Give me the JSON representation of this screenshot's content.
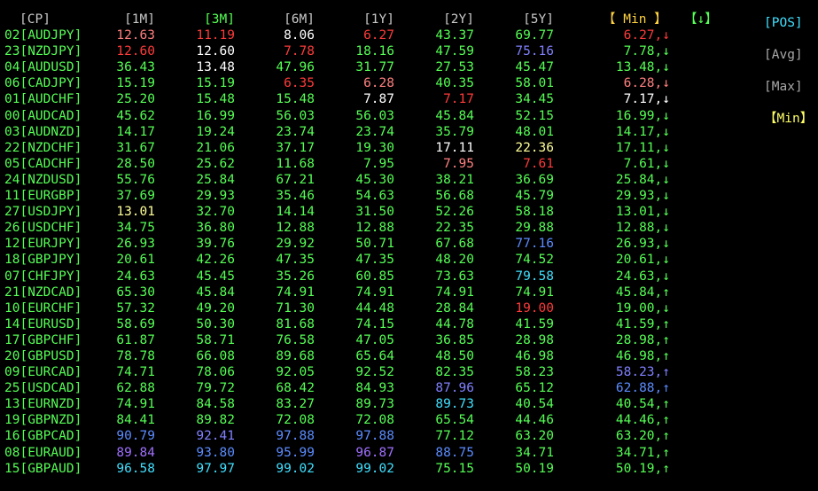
{
  "colors": {
    "green": "#55ff55",
    "white": "#ffffff",
    "red": "#ff3b3b",
    "yellow": "#ffff66",
    "blue": "#5b8cff",
    "purple": "#a070ff",
    "cyan": "#40e0ff",
    "gray": "#a8a8a8",
    "header": "#c8c8c8",
    "min_header": "#ffd23f",
    "sort_header": "#55ff55"
  },
  "headers": {
    "cp": "[CP]",
    "m1": "[1M]",
    "m3": "[3M]",
    "m6": "[6M]",
    "y1": "[1Y]",
    "y2": "[2Y]",
    "y5": "[5Y]",
    "min": "【 Min 】",
    "sort": "【↓】"
  },
  "side_menu": [
    {
      "label": "[POS]",
      "color": "#40e0ff"
    },
    {
      "label": "[Avg]",
      "color": "#a8a8a8"
    },
    {
      "label": "[Max]",
      "color": "#a8a8a8"
    },
    {
      "label": "【Min】",
      "color": "#ffff66"
    }
  ],
  "rows": [
    {
      "pair": "02[AUDJPY]",
      "vals": [
        [
          "12.63",
          "#ff8080"
        ],
        [
          "11.19",
          "#ff3b3b"
        ],
        [
          "8.06",
          "#ffffff"
        ],
        [
          "6.27",
          "#ff3b3b"
        ],
        [
          "43.37",
          "#55ff55"
        ],
        [
          "69.77",
          "#55ff55"
        ]
      ],
      "min": [
        "6.27,",
        "#ff3b3b"
      ],
      "arrow": "↓"
    },
    {
      "pair": "23[NZDJPY]",
      "vals": [
        [
          "12.60",
          "#ff3b3b"
        ],
        [
          "12.60",
          "#ffffff"
        ],
        [
          "7.78",
          "#ff3b3b"
        ],
        [
          "18.16",
          "#55ff55"
        ],
        [
          "47.59",
          "#55ff55"
        ],
        [
          "75.16",
          "#8080ff"
        ]
      ],
      "min": [
        "7.78,",
        "#55ff55"
      ],
      "arrow": "↓"
    },
    {
      "pair": "04[AUDUSD]",
      "vals": [
        [
          "36.43",
          "#55ff55"
        ],
        [
          "13.48",
          "#ffffff"
        ],
        [
          "47.96",
          "#55ff55"
        ],
        [
          "31.77",
          "#55ff55"
        ],
        [
          "27.53",
          "#55ff55"
        ],
        [
          "45.47",
          "#55ff55"
        ]
      ],
      "min": [
        "13.48,",
        "#55ff55"
      ],
      "arrow": "↓"
    },
    {
      "pair": "06[CADJPY]",
      "vals": [
        [
          "15.19",
          "#55ff55"
        ],
        [
          "15.19",
          "#55ff55"
        ],
        [
          "6.35",
          "#ff3b3b"
        ],
        [
          "6.28",
          "#ff8080"
        ],
        [
          "40.35",
          "#55ff55"
        ],
        [
          "58.01",
          "#55ff55"
        ]
      ],
      "min": [
        "6.28,",
        "#ff8080"
      ],
      "arrow": "↓"
    },
    {
      "pair": "01[AUDCHF]",
      "vals": [
        [
          "25.20",
          "#55ff55"
        ],
        [
          "15.48",
          "#55ff55"
        ],
        [
          "15.48",
          "#55ff55"
        ],
        [
          "7.87",
          "#ffffff"
        ],
        [
          "7.17",
          "#ff3b3b"
        ],
        [
          "34.45",
          "#55ff55"
        ]
      ],
      "min": [
        "7.17,",
        "#ffffff"
      ],
      "arrow": "↓"
    },
    {
      "pair": "00[AUDCAD]",
      "vals": [
        [
          "45.62",
          "#55ff55"
        ],
        [
          "16.99",
          "#55ff55"
        ],
        [
          "56.03",
          "#55ff55"
        ],
        [
          "56.03",
          "#55ff55"
        ],
        [
          "45.84",
          "#55ff55"
        ],
        [
          "52.15",
          "#55ff55"
        ]
      ],
      "min": [
        "16.99,",
        "#55ff55"
      ],
      "arrow": "↓"
    },
    {
      "pair": "03[AUDNZD]",
      "vals": [
        [
          "14.17",
          "#55ff55"
        ],
        [
          "19.24",
          "#55ff55"
        ],
        [
          "23.74",
          "#55ff55"
        ],
        [
          "23.74",
          "#55ff55"
        ],
        [
          "35.79",
          "#55ff55"
        ],
        [
          "48.01",
          "#55ff55"
        ]
      ],
      "min": [
        "14.17,",
        "#55ff55"
      ],
      "arrow": "↓"
    },
    {
      "pair": "22[NZDCHF]",
      "vals": [
        [
          "31.67",
          "#55ff55"
        ],
        [
          "21.06",
          "#55ff55"
        ],
        [
          "37.17",
          "#55ff55"
        ],
        [
          "19.30",
          "#55ff55"
        ],
        [
          "17.11",
          "#ffffff"
        ],
        [
          "22.36",
          "#ffff99"
        ]
      ],
      "min": [
        "17.11,",
        "#55ff55"
      ],
      "arrow": "↓"
    },
    {
      "pair": "05[CADCHF]",
      "vals": [
        [
          "28.50",
          "#55ff55"
        ],
        [
          "25.62",
          "#55ff55"
        ],
        [
          "11.68",
          "#55ff55"
        ],
        [
          "7.95",
          "#55ff55"
        ],
        [
          "7.95",
          "#ff8080"
        ],
        [
          "7.61",
          "#ff3b3b"
        ]
      ],
      "min": [
        "7.61,",
        "#55ff55"
      ],
      "arrow": "↓"
    },
    {
      "pair": "24[NZDUSD]",
      "vals": [
        [
          "55.76",
          "#55ff55"
        ],
        [
          "25.84",
          "#55ff55"
        ],
        [
          "67.21",
          "#55ff55"
        ],
        [
          "45.30",
          "#55ff55"
        ],
        [
          "38.21",
          "#55ff55"
        ],
        [
          "36.69",
          "#55ff55"
        ]
      ],
      "min": [
        "25.84,",
        "#55ff55"
      ],
      "arrow": "↓"
    },
    {
      "pair": "11[EURGBP]",
      "vals": [
        [
          "37.69",
          "#55ff55"
        ],
        [
          "29.93",
          "#55ff55"
        ],
        [
          "35.46",
          "#55ff55"
        ],
        [
          "54.63",
          "#55ff55"
        ],
        [
          "56.68",
          "#55ff55"
        ],
        [
          "45.79",
          "#55ff55"
        ]
      ],
      "min": [
        "29.93,",
        "#55ff55"
      ],
      "arrow": "↓"
    },
    {
      "pair": "27[USDJPY]",
      "vals": [
        [
          "13.01",
          "#ffff99"
        ],
        [
          "32.70",
          "#55ff55"
        ],
        [
          "14.14",
          "#55ff55"
        ],
        [
          "31.50",
          "#55ff55"
        ],
        [
          "52.26",
          "#55ff55"
        ],
        [
          "58.18",
          "#55ff55"
        ]
      ],
      "min": [
        "13.01,",
        "#55ff55"
      ],
      "arrow": "↓"
    },
    {
      "pair": "26[USDCHF]",
      "vals": [
        [
          "34.75",
          "#55ff55"
        ],
        [
          "36.80",
          "#55ff55"
        ],
        [
          "12.88",
          "#55ff55"
        ],
        [
          "12.88",
          "#55ff55"
        ],
        [
          "22.35",
          "#55ff55"
        ],
        [
          "29.88",
          "#55ff55"
        ]
      ],
      "min": [
        "12.88,",
        "#55ff55"
      ],
      "arrow": "↓"
    },
    {
      "pair": "12[EURJPY]",
      "vals": [
        [
          "26.93",
          "#55ff55"
        ],
        [
          "39.76",
          "#55ff55"
        ],
        [
          "29.92",
          "#55ff55"
        ],
        [
          "50.71",
          "#55ff55"
        ],
        [
          "67.68",
          "#55ff55"
        ],
        [
          "77.16",
          "#5b8cff"
        ]
      ],
      "min": [
        "26.93,",
        "#55ff55"
      ],
      "arrow": "↓"
    },
    {
      "pair": "18[GBPJPY]",
      "vals": [
        [
          "20.61",
          "#55ff55"
        ],
        [
          "42.26",
          "#55ff55"
        ],
        [
          "47.35",
          "#55ff55"
        ],
        [
          "47.35",
          "#55ff55"
        ],
        [
          "48.20",
          "#55ff55"
        ],
        [
          "74.52",
          "#55ff55"
        ]
      ],
      "min": [
        "20.61,",
        "#55ff55"
      ],
      "arrow": "↓"
    },
    {
      "pair": "07[CHFJPY]",
      "vals": [
        [
          "24.63",
          "#55ff55"
        ],
        [
          "45.45",
          "#55ff55"
        ],
        [
          "35.26",
          "#55ff55"
        ],
        [
          "60.85",
          "#55ff55"
        ],
        [
          "73.63",
          "#55ff55"
        ],
        [
          "79.58",
          "#40e0ff"
        ]
      ],
      "min": [
        "24.63,",
        "#55ff55"
      ],
      "arrow": "↓"
    },
    {
      "pair": "21[NZDCAD]",
      "vals": [
        [
          "65.30",
          "#55ff55"
        ],
        [
          "45.84",
          "#55ff55"
        ],
        [
          "74.91",
          "#55ff55"
        ],
        [
          "74.91",
          "#55ff55"
        ],
        [
          "74.91",
          "#55ff55"
        ],
        [
          "74.91",
          "#55ff55"
        ]
      ],
      "min": [
        "45.84,",
        "#55ff55"
      ],
      "arrow": "↑"
    },
    {
      "pair": "10[EURCHF]",
      "vals": [
        [
          "57.32",
          "#55ff55"
        ],
        [
          "49.20",
          "#55ff55"
        ],
        [
          "71.30",
          "#55ff55"
        ],
        [
          "44.48",
          "#55ff55"
        ],
        [
          "28.84",
          "#55ff55"
        ],
        [
          "19.00",
          "#ff3b3b"
        ]
      ],
      "min": [
        "19.00,",
        "#55ff55"
      ],
      "arrow": "↓"
    },
    {
      "pair": "14[EURUSD]",
      "vals": [
        [
          "58.69",
          "#55ff55"
        ],
        [
          "50.30",
          "#55ff55"
        ],
        [
          "81.68",
          "#55ff55"
        ],
        [
          "74.15",
          "#55ff55"
        ],
        [
          "44.78",
          "#55ff55"
        ],
        [
          "41.59",
          "#55ff55"
        ]
      ],
      "min": [
        "41.59,",
        "#55ff55"
      ],
      "arrow": "↑"
    },
    {
      "pair": "17[GBPCHF]",
      "vals": [
        [
          "61.87",
          "#55ff55"
        ],
        [
          "58.71",
          "#55ff55"
        ],
        [
          "76.58",
          "#55ff55"
        ],
        [
          "47.05",
          "#55ff55"
        ],
        [
          "36.85",
          "#55ff55"
        ],
        [
          "28.98",
          "#55ff55"
        ]
      ],
      "min": [
        "28.98,",
        "#55ff55"
      ],
      "arrow": "↑"
    },
    {
      "pair": "20[GBPUSD]",
      "vals": [
        [
          "78.78",
          "#55ff55"
        ],
        [
          "66.08",
          "#55ff55"
        ],
        [
          "89.68",
          "#55ff55"
        ],
        [
          "65.64",
          "#55ff55"
        ],
        [
          "48.50",
          "#55ff55"
        ],
        [
          "46.98",
          "#55ff55"
        ]
      ],
      "min": [
        "46.98,",
        "#55ff55"
      ],
      "arrow": "↑"
    },
    {
      "pair": "09[EURCAD]",
      "vals": [
        [
          "74.71",
          "#55ff55"
        ],
        [
          "78.06",
          "#55ff55"
        ],
        [
          "92.05",
          "#55ff55"
        ],
        [
          "92.52",
          "#55ff55"
        ],
        [
          "82.35",
          "#55ff55"
        ],
        [
          "58.23",
          "#55ff55"
        ]
      ],
      "min": [
        "58.23,",
        "#8080ff"
      ],
      "arrow": "↑"
    },
    {
      "pair": "25[USDCAD]",
      "vals": [
        [
          "62.88",
          "#55ff55"
        ],
        [
          "79.72",
          "#55ff55"
        ],
        [
          "68.42",
          "#55ff55"
        ],
        [
          "84.93",
          "#55ff55"
        ],
        [
          "87.96",
          "#8080ff"
        ],
        [
          "65.12",
          "#55ff55"
        ]
      ],
      "min": [
        "62.88,",
        "#5b8cff"
      ],
      "arrow": "↑"
    },
    {
      "pair": "13[EURNZD]",
      "vals": [
        [
          "74.91",
          "#55ff55"
        ],
        [
          "84.58",
          "#55ff55"
        ],
        [
          "83.27",
          "#55ff55"
        ],
        [
          "89.73",
          "#55ff55"
        ],
        [
          "89.73",
          "#40e0ff"
        ],
        [
          "40.54",
          "#55ff55"
        ]
      ],
      "min": [
        "40.54,",
        "#55ff55"
      ],
      "arrow": "↑"
    },
    {
      "pair": "19[GBPNZD]",
      "vals": [
        [
          "84.41",
          "#55ff55"
        ],
        [
          "89.82",
          "#55ff55"
        ],
        [
          "72.08",
          "#55ff55"
        ],
        [
          "72.08",
          "#55ff55"
        ],
        [
          "65.54",
          "#55ff55"
        ],
        [
          "44.46",
          "#55ff55"
        ]
      ],
      "min": [
        "44.46,",
        "#55ff55"
      ],
      "arrow": "↑"
    },
    {
      "pair": "16[GBPCAD]",
      "vals": [
        [
          "90.79",
          "#5b8cff"
        ],
        [
          "92.41",
          "#8080ff"
        ],
        [
          "97.88",
          "#5b8cff"
        ],
        [
          "97.88",
          "#5b8cff"
        ],
        [
          "77.12",
          "#55ff55"
        ],
        [
          "63.20",
          "#55ff55"
        ]
      ],
      "min": [
        "63.20,",
        "#55ff55"
      ],
      "arrow": "↑"
    },
    {
      "pair": "08[EURAUD]",
      "vals": [
        [
          "89.84",
          "#a070ff"
        ],
        [
          "93.80",
          "#5b8cff"
        ],
        [
          "95.99",
          "#5b8cff"
        ],
        [
          "96.87",
          "#a070ff"
        ],
        [
          "88.75",
          "#5b8cff"
        ],
        [
          "34.71",
          "#55ff55"
        ]
      ],
      "min": [
        "34.71,",
        "#55ff55"
      ],
      "arrow": "↑"
    },
    {
      "pair": "15[GBPAUD]",
      "vals": [
        [
          "96.58",
          "#40e0ff"
        ],
        [
          "97.97",
          "#40e0ff"
        ],
        [
          "99.02",
          "#40e0ff"
        ],
        [
          "99.02",
          "#40e0ff"
        ],
        [
          "75.15",
          "#55ff55"
        ],
        [
          "50.19",
          "#55ff55"
        ]
      ],
      "min": [
        "50.19,",
        "#55ff55"
      ],
      "arrow": "↑"
    }
  ]
}
